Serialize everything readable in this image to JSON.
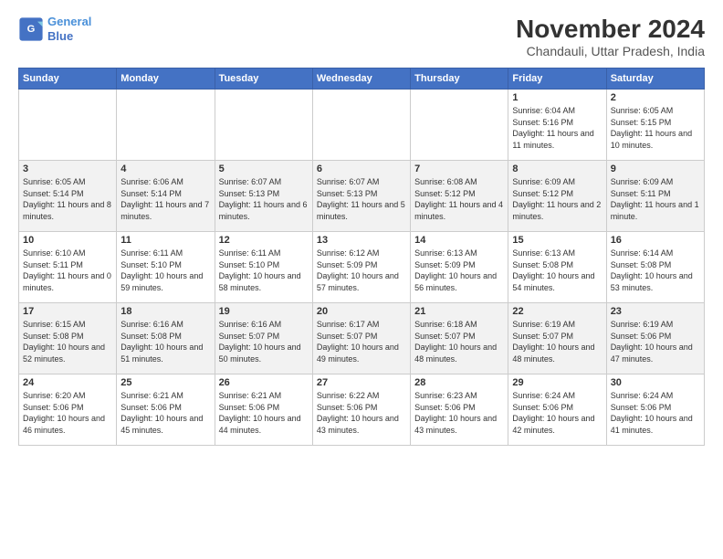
{
  "logo": {
    "line1": "General",
    "line2": "Blue"
  },
  "title": "November 2024",
  "location": "Chandauli, Uttar Pradesh, India",
  "headers": [
    "Sunday",
    "Monday",
    "Tuesday",
    "Wednesday",
    "Thursday",
    "Friday",
    "Saturday"
  ],
  "weeks": [
    [
      {
        "day": "",
        "info": ""
      },
      {
        "day": "",
        "info": ""
      },
      {
        "day": "",
        "info": ""
      },
      {
        "day": "",
        "info": ""
      },
      {
        "day": "",
        "info": ""
      },
      {
        "day": "1",
        "info": "Sunrise: 6:04 AM\nSunset: 5:16 PM\nDaylight: 11 hours and 11 minutes."
      },
      {
        "day": "2",
        "info": "Sunrise: 6:05 AM\nSunset: 5:15 PM\nDaylight: 11 hours and 10 minutes."
      }
    ],
    [
      {
        "day": "3",
        "info": "Sunrise: 6:05 AM\nSunset: 5:14 PM\nDaylight: 11 hours and 8 minutes."
      },
      {
        "day": "4",
        "info": "Sunrise: 6:06 AM\nSunset: 5:14 PM\nDaylight: 11 hours and 7 minutes."
      },
      {
        "day": "5",
        "info": "Sunrise: 6:07 AM\nSunset: 5:13 PM\nDaylight: 11 hours and 6 minutes."
      },
      {
        "day": "6",
        "info": "Sunrise: 6:07 AM\nSunset: 5:13 PM\nDaylight: 11 hours and 5 minutes."
      },
      {
        "day": "7",
        "info": "Sunrise: 6:08 AM\nSunset: 5:12 PM\nDaylight: 11 hours and 4 minutes."
      },
      {
        "day": "8",
        "info": "Sunrise: 6:09 AM\nSunset: 5:12 PM\nDaylight: 11 hours and 2 minutes."
      },
      {
        "day": "9",
        "info": "Sunrise: 6:09 AM\nSunset: 5:11 PM\nDaylight: 11 hours and 1 minute."
      }
    ],
    [
      {
        "day": "10",
        "info": "Sunrise: 6:10 AM\nSunset: 5:11 PM\nDaylight: 11 hours and 0 minutes."
      },
      {
        "day": "11",
        "info": "Sunrise: 6:11 AM\nSunset: 5:10 PM\nDaylight: 10 hours and 59 minutes."
      },
      {
        "day": "12",
        "info": "Sunrise: 6:11 AM\nSunset: 5:10 PM\nDaylight: 10 hours and 58 minutes."
      },
      {
        "day": "13",
        "info": "Sunrise: 6:12 AM\nSunset: 5:09 PM\nDaylight: 10 hours and 57 minutes."
      },
      {
        "day": "14",
        "info": "Sunrise: 6:13 AM\nSunset: 5:09 PM\nDaylight: 10 hours and 56 minutes."
      },
      {
        "day": "15",
        "info": "Sunrise: 6:13 AM\nSunset: 5:08 PM\nDaylight: 10 hours and 54 minutes."
      },
      {
        "day": "16",
        "info": "Sunrise: 6:14 AM\nSunset: 5:08 PM\nDaylight: 10 hours and 53 minutes."
      }
    ],
    [
      {
        "day": "17",
        "info": "Sunrise: 6:15 AM\nSunset: 5:08 PM\nDaylight: 10 hours and 52 minutes."
      },
      {
        "day": "18",
        "info": "Sunrise: 6:16 AM\nSunset: 5:08 PM\nDaylight: 10 hours and 51 minutes."
      },
      {
        "day": "19",
        "info": "Sunrise: 6:16 AM\nSunset: 5:07 PM\nDaylight: 10 hours and 50 minutes."
      },
      {
        "day": "20",
        "info": "Sunrise: 6:17 AM\nSunset: 5:07 PM\nDaylight: 10 hours and 49 minutes."
      },
      {
        "day": "21",
        "info": "Sunrise: 6:18 AM\nSunset: 5:07 PM\nDaylight: 10 hours and 48 minutes."
      },
      {
        "day": "22",
        "info": "Sunrise: 6:19 AM\nSunset: 5:07 PM\nDaylight: 10 hours and 48 minutes."
      },
      {
        "day": "23",
        "info": "Sunrise: 6:19 AM\nSunset: 5:06 PM\nDaylight: 10 hours and 47 minutes."
      }
    ],
    [
      {
        "day": "24",
        "info": "Sunrise: 6:20 AM\nSunset: 5:06 PM\nDaylight: 10 hours and 46 minutes."
      },
      {
        "day": "25",
        "info": "Sunrise: 6:21 AM\nSunset: 5:06 PM\nDaylight: 10 hours and 45 minutes."
      },
      {
        "day": "26",
        "info": "Sunrise: 6:21 AM\nSunset: 5:06 PM\nDaylight: 10 hours and 44 minutes."
      },
      {
        "day": "27",
        "info": "Sunrise: 6:22 AM\nSunset: 5:06 PM\nDaylight: 10 hours and 43 minutes."
      },
      {
        "day": "28",
        "info": "Sunrise: 6:23 AM\nSunset: 5:06 PM\nDaylight: 10 hours and 43 minutes."
      },
      {
        "day": "29",
        "info": "Sunrise: 6:24 AM\nSunset: 5:06 PM\nDaylight: 10 hours and 42 minutes."
      },
      {
        "day": "30",
        "info": "Sunrise: 6:24 AM\nSunset: 5:06 PM\nDaylight: 10 hours and 41 minutes."
      }
    ]
  ]
}
